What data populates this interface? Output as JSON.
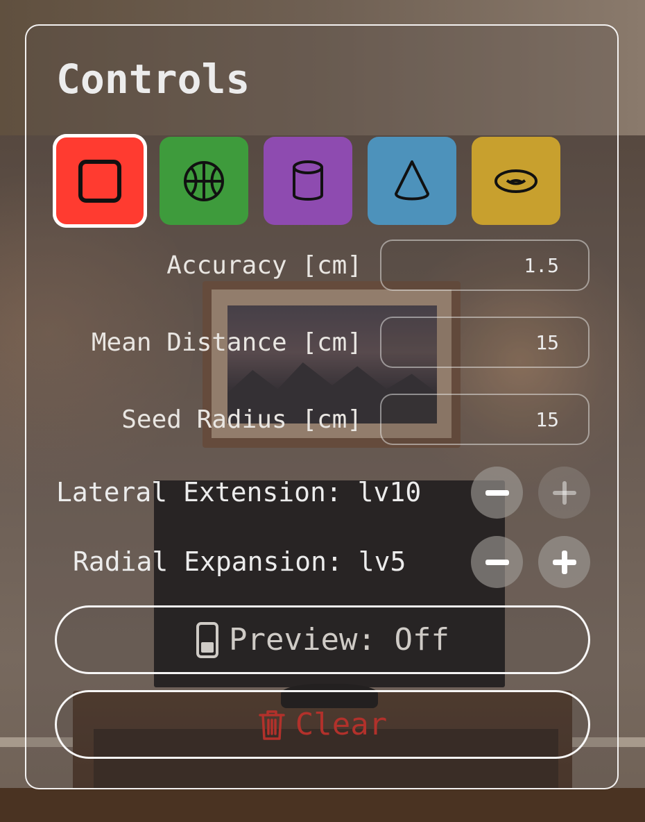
{
  "panel": {
    "title": "Controls"
  },
  "shapes": [
    {
      "icon": "square-icon",
      "color": "#ff3b30",
      "selected": true
    },
    {
      "icon": "basketball-icon",
      "color": "#3e9b3c",
      "selected": false
    },
    {
      "icon": "cylinder-icon",
      "color": "#8e4bb0",
      "selected": false
    },
    {
      "icon": "cone-icon",
      "color": "#4d92bb",
      "selected": false
    },
    {
      "icon": "torus-icon",
      "color": "#c8a02e",
      "selected": false
    }
  ],
  "params": {
    "accuracy": {
      "label": "Accuracy [cm]",
      "value": "1.5"
    },
    "mean_distance": {
      "label": "Mean Distance [cm]",
      "value": "15"
    },
    "seed_radius": {
      "label": "Seed Radius [cm]",
      "value": "15"
    }
  },
  "steppers": {
    "lateral": {
      "label": "Lateral Extension: lv10",
      "minus_enabled": true,
      "plus_enabled": false
    },
    "radial": {
      "label": "Radial Expansion: lv5",
      "minus_enabled": true,
      "plus_enabled": true
    }
  },
  "preview_button": {
    "label": "Preview: Off",
    "icon": "phone-icon",
    "color": "#cfcbc6"
  },
  "clear_button": {
    "label": "Clear",
    "icon": "trash-icon",
    "color": "#b2312b"
  }
}
